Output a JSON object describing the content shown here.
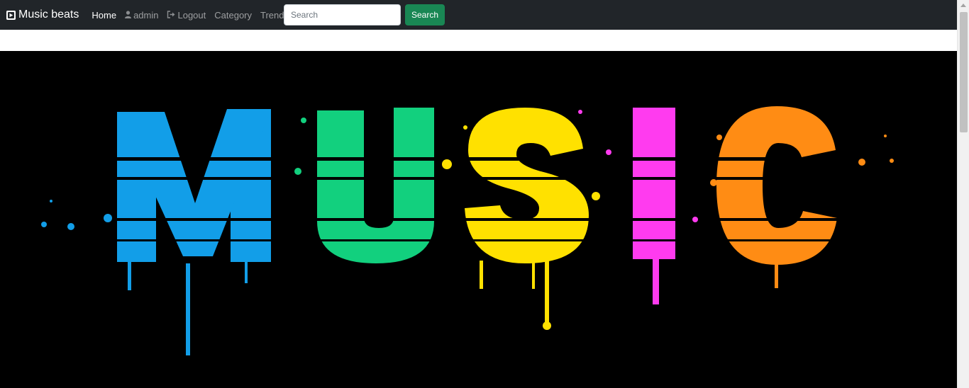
{
  "navbar": {
    "brand": "Music beats",
    "links": {
      "home": "Home",
      "user": "admin",
      "logout": "Logout",
      "category": "Category",
      "trending": "Trending"
    },
    "search": {
      "placeholder": "Search",
      "value": "",
      "button_label": "Search"
    }
  },
  "hero": {
    "word": "MUSIC",
    "letter_colors": [
      "#129ee8",
      "#12d07e",
      "#ffe100",
      "#ff3bef",
      "#ff8c14"
    ]
  },
  "colors": {
    "navbar_bg": "#212529",
    "search_button": "#198754"
  },
  "icons": {
    "brand": "play-square-icon",
    "user": "user-icon",
    "logout": "sign-out-icon"
  }
}
